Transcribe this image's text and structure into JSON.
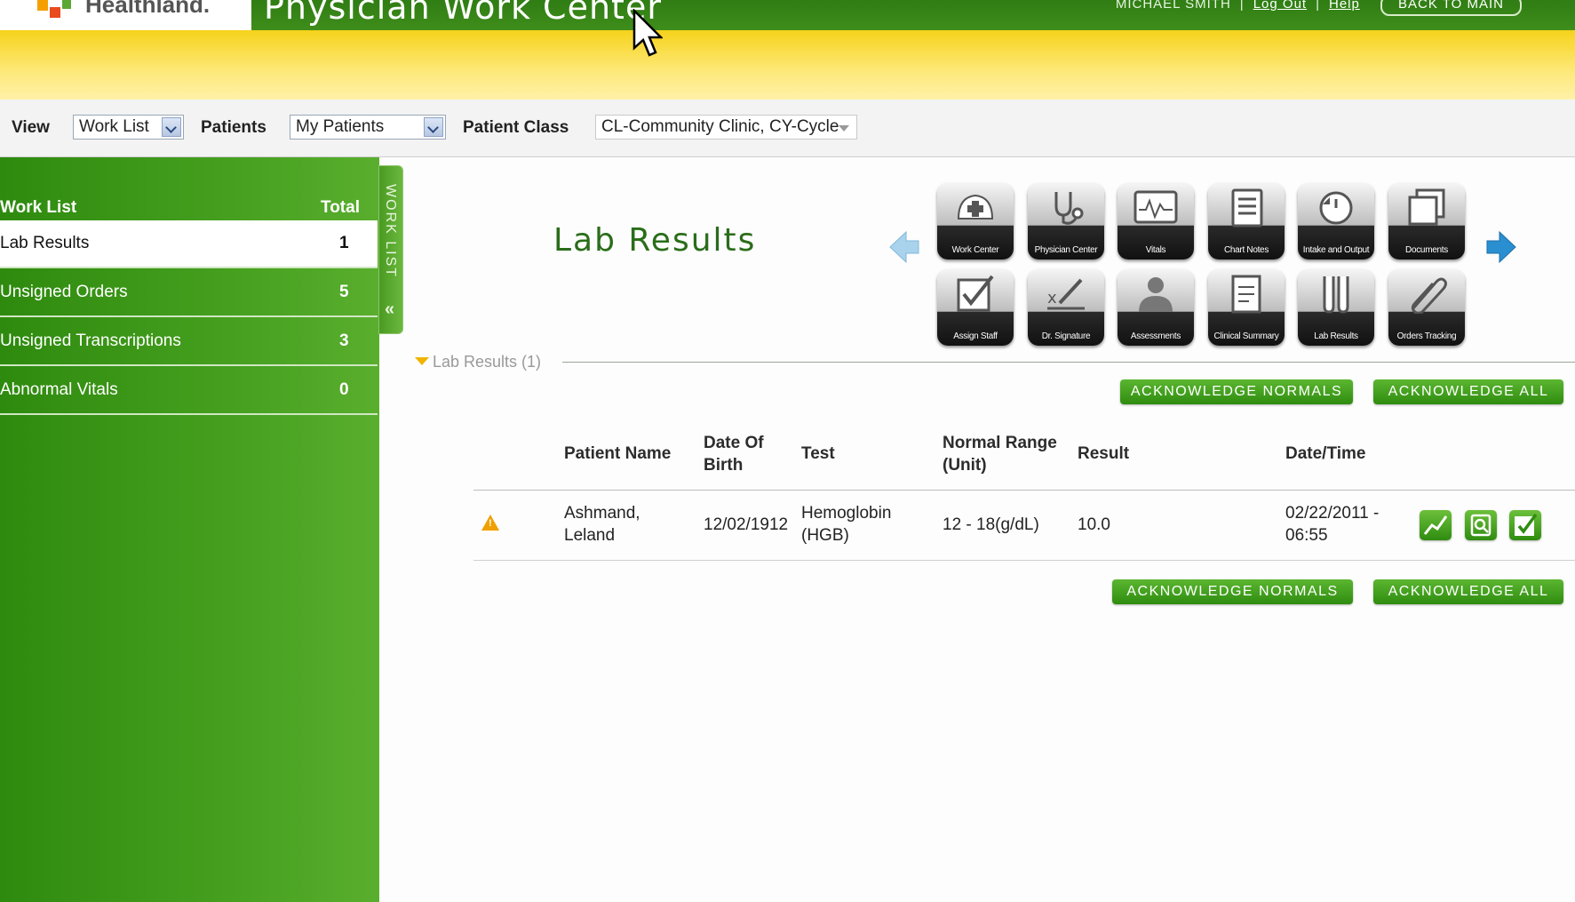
{
  "header": {
    "brand": "Healthland.",
    "app_title": "Physician Work Center",
    "user_name": "MICHAEL SMITH",
    "logout_label": "Log Out",
    "help_label": "Help",
    "back_label": "BACK TO MAIN"
  },
  "filters": {
    "view_label": "View",
    "view_value": "Work List",
    "patients_label": "Patients",
    "patients_value": "My Patients",
    "patient_class_label": "Patient Class",
    "patient_class_value": "CL-Community Clinic, CY-Cycle"
  },
  "worklist": {
    "title": "Work List",
    "total_label": "Total",
    "tab_label": "WORK LIST",
    "items": [
      {
        "label": "Lab Results",
        "count": "1"
      },
      {
        "label": "Unsigned Orders",
        "count": "5"
      },
      {
        "label": "Unsigned Transcriptions",
        "count": "3"
      },
      {
        "label": "Abnormal Vitals",
        "count": "0"
      }
    ]
  },
  "main": {
    "title": "Lab Results",
    "section_label": "Lab Results (1)",
    "ack_normals_label": "ACKNOWLEDGE NORMALS",
    "ack_all_label": "ACKNOWLEDGE ALL"
  },
  "toolbar_icons": [
    {
      "name": "work-center-icon",
      "label": "Work Center"
    },
    {
      "name": "physician-center-icon",
      "label": "Physician Center"
    },
    {
      "name": "vitals-icon",
      "label": "Vitals"
    },
    {
      "name": "chart-notes-icon",
      "label": "Chart Notes"
    },
    {
      "name": "intake-output-icon",
      "label": "Intake and Output"
    },
    {
      "name": "documents-icon",
      "label": "Documents"
    },
    {
      "name": "assign-staff-icon",
      "label": "Assign Staff"
    },
    {
      "name": "dr-signature-icon",
      "label": "Dr. Signature"
    },
    {
      "name": "assessments-icon",
      "label": "Assessments"
    },
    {
      "name": "clinical-summary-icon",
      "label": "Clinical Summary"
    },
    {
      "name": "lab-results-icon",
      "label": "Lab Results"
    },
    {
      "name": "orders-tracking-icon",
      "label": "Orders Tracking"
    }
  ],
  "table": {
    "headers": {
      "patient_name": "Patient Name",
      "dob_1": "Date Of",
      "dob_2": "Birth",
      "test": "Test",
      "range_1": "Normal Range",
      "range_2": "(Unit)",
      "result": "Result",
      "datetime": "Date/Time"
    },
    "rows": [
      {
        "name_1": "Ashmand,",
        "name_2": "Leland",
        "dob": "12/02/1912",
        "test_1": "Hemoglobin",
        "test_2": "(HGB)",
        "range": "12 - 18(g/dL)",
        "result": "10.0",
        "datetime_1": "02/22/2011 -",
        "datetime_2": "06:55"
      }
    ]
  },
  "colors": {
    "header_green": "#3f8d1a",
    "sidebar_green": "#4aa322",
    "accent_yellow": "#f6d21b",
    "warning_orange": "#f0a000"
  }
}
